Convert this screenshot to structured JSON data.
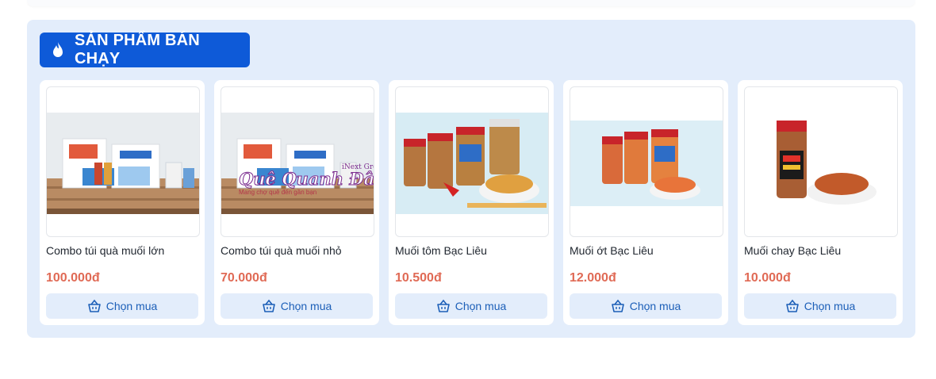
{
  "section": {
    "title": "SẢN PHẨM BÁN CHẠY",
    "icon": "fire-icon",
    "accent": "#0e5ad8",
    "background": "#e3edfb"
  },
  "products": [
    {
      "name": "Combo túi quà muối lớn",
      "price": "100.000đ",
      "button": "Chọn mua",
      "image": "gift-bag-combo-large"
    },
    {
      "name": "Combo túi quà muối nhỏ",
      "price": "70.000đ",
      "button": "Chọn mua",
      "image": "gift-bag-combo-small",
      "watermark": "Quê Quanh Đây.com",
      "watermark_sub": "Mang chợ quê đến gần bạn",
      "watermark_brand": "iNext Group"
    },
    {
      "name": "Muối tôm Bạc Liêu",
      "price": "10.500đ",
      "button": "Chọn mua",
      "image": "shrimp-salt-jars"
    },
    {
      "name": "Muối ớt Bạc Liêu",
      "price": "12.000đ",
      "button": "Chọn mua",
      "image": "chili-salt-jars"
    },
    {
      "name": "Muối chay Bạc Liêu",
      "price": "10.000đ",
      "button": "Chọn mua",
      "image": "vegan-salt-jar"
    }
  ],
  "colors": {
    "price": "#e06a55",
    "button_text": "#1c5fb8"
  }
}
